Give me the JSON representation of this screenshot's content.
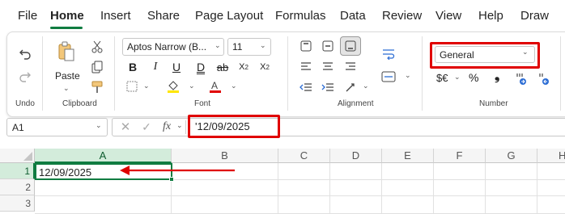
{
  "menu": {
    "tabs": [
      "File",
      "Home",
      "Insert",
      "Share",
      "Page Layout",
      "Formulas",
      "Data",
      "Review",
      "View",
      "Help",
      "Draw"
    ],
    "active": "Home"
  },
  "undo_group": {
    "label": "Undo"
  },
  "clipboard_group": {
    "paste_label": "Paste",
    "label": "Clipboard"
  },
  "font_group": {
    "font_name": "Aptos Narrow (B...",
    "font_size": "11",
    "label": "Font"
  },
  "alignment_group": {
    "label": "Alignment"
  },
  "number_group": {
    "format": "General",
    "currency_symbol": "$€",
    "percent_symbol": "%",
    "comma_symbol": "❟",
    "label": "Number"
  },
  "formula_bar": {
    "name_box": "A1",
    "fx_label": "fx",
    "content": "'12/09/2025"
  },
  "sheet": {
    "columns": [
      "A",
      "B",
      "C",
      "D",
      "E",
      "F",
      "G",
      "H"
    ],
    "rows": [
      "1",
      "2",
      "3"
    ],
    "a1_value": "12/09/2025"
  },
  "colors": {
    "accent_green": "#107c41",
    "selection_fill": "#d3ecdb",
    "annotation_red": "#e00000"
  }
}
